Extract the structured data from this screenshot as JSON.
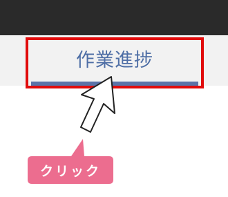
{
  "nav": {
    "active_tab_label": "作業進捗"
  },
  "annotation": {
    "callout_text": "クリック"
  },
  "colors": {
    "topbar": "#2a2a2a",
    "tab_text": "#4f6fa6",
    "highlight": "#e10b0b",
    "callout": "#ec6d8f"
  },
  "icons": {
    "cursor": "mouse-pointer-icon"
  }
}
